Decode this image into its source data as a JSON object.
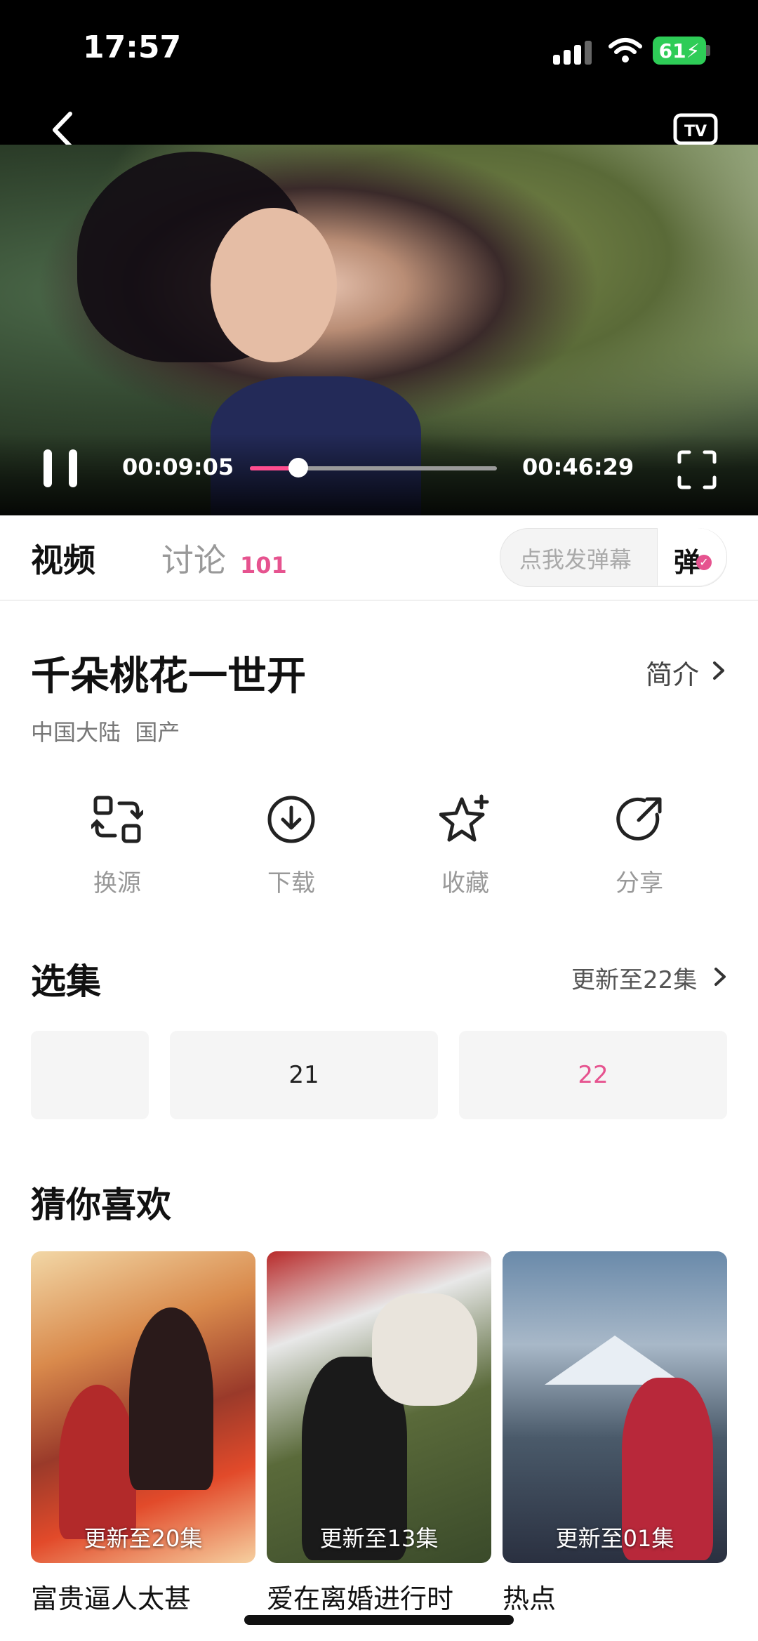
{
  "status_bar": {
    "time": "17:57",
    "battery": "61"
  },
  "player": {
    "current_time": "00:09:05",
    "total_time": "00:46:29",
    "progress": 0.196
  },
  "tabs": {
    "video": "视频",
    "discuss": "讨论",
    "discuss_count": "101"
  },
  "danmaku": {
    "placeholder": "点我发弹幕",
    "button": "弹"
  },
  "show": {
    "title": "千朵桃花一世开",
    "intro": "简介",
    "meta": "中国大陆  国产"
  },
  "actions": [
    {
      "label": "换源",
      "icon": "switch-source-icon"
    },
    {
      "label": "下载",
      "icon": "download-icon"
    },
    {
      "label": "收藏",
      "icon": "favorite-star-icon"
    },
    {
      "label": "分享",
      "icon": "share-icon"
    }
  ],
  "episodes": {
    "title": "选集",
    "update": "更新至22集",
    "items": [
      "",
      "21",
      "22"
    ],
    "active_color": "#e6538f"
  },
  "recommend": {
    "title": "猜你喜欢",
    "items": [
      {
        "title": "富贵逼人太甚",
        "badge": "更新至20集"
      },
      {
        "title": "爱在离婚进行时",
        "badge": "更新至13集"
      },
      {
        "title": "热点",
        "badge": "更新至01集"
      }
    ]
  },
  "colors": {
    "accent": "#e6538f",
    "battery": "#2ecc57"
  }
}
